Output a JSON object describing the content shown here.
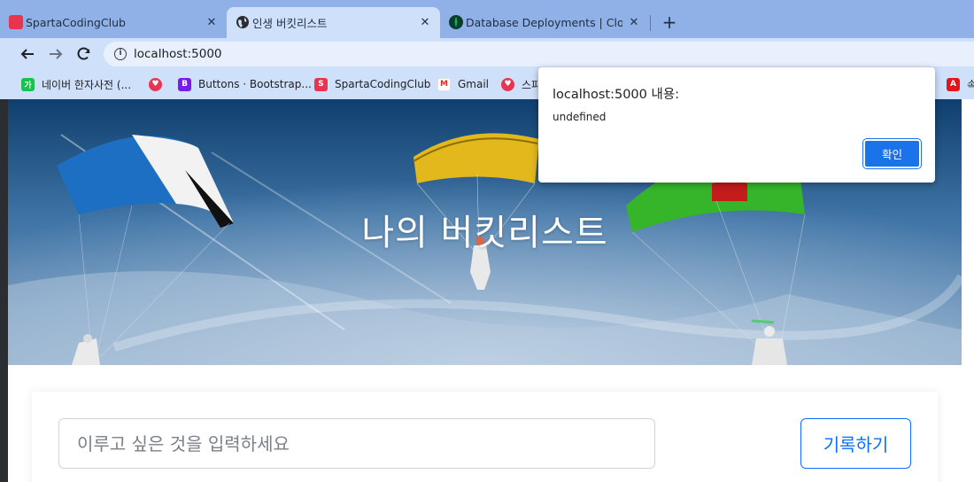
{
  "tabs": [
    {
      "title": "SpartaCodingClub",
      "icon": "sparta-logo-icon",
      "active": false
    },
    {
      "title": "인생 버킷리스트",
      "icon": "globe-icon",
      "active": true
    },
    {
      "title": "Database Deployments | Cloud",
      "icon": "mongodb-leaf-icon",
      "active": false
    }
  ],
  "tab_close_glyph": "✕",
  "new_tab_glyph": "+",
  "address_bar": {
    "url": "localhost:5000"
  },
  "bookmarks": [
    {
      "label": "네이버 한자사전 (...",
      "icon": "naver-icon"
    },
    {
      "label": "",
      "icon": "heart-link-icon"
    },
    {
      "label": "Buttons · Bootstrap...",
      "icon": "bootstrap-icon"
    },
    {
      "label": "SpartaCodingClub",
      "icon": "sparta-logo-icon"
    },
    {
      "label": "Gmail",
      "icon": "gmail-icon"
    },
    {
      "label": "스파",
      "icon": "heart-link-icon"
    },
    {
      "label": "속",
      "icon": "adobe-icon"
    }
  ],
  "hero": {
    "title": "나의 버킷리스트"
  },
  "form": {
    "input_placeholder": "이루고 싶은 것을 입력하세요",
    "submit_label": "기록하기"
  },
  "alert_dialog": {
    "title": "localhost:5000 내용:",
    "message": "undefined",
    "ok_label": "확인"
  },
  "colors": {
    "tabstrip": "#8fb1e8",
    "toolbar": "#cfe0fb",
    "primary": "#0d6efd",
    "dialog_button": "#1a73e8"
  }
}
